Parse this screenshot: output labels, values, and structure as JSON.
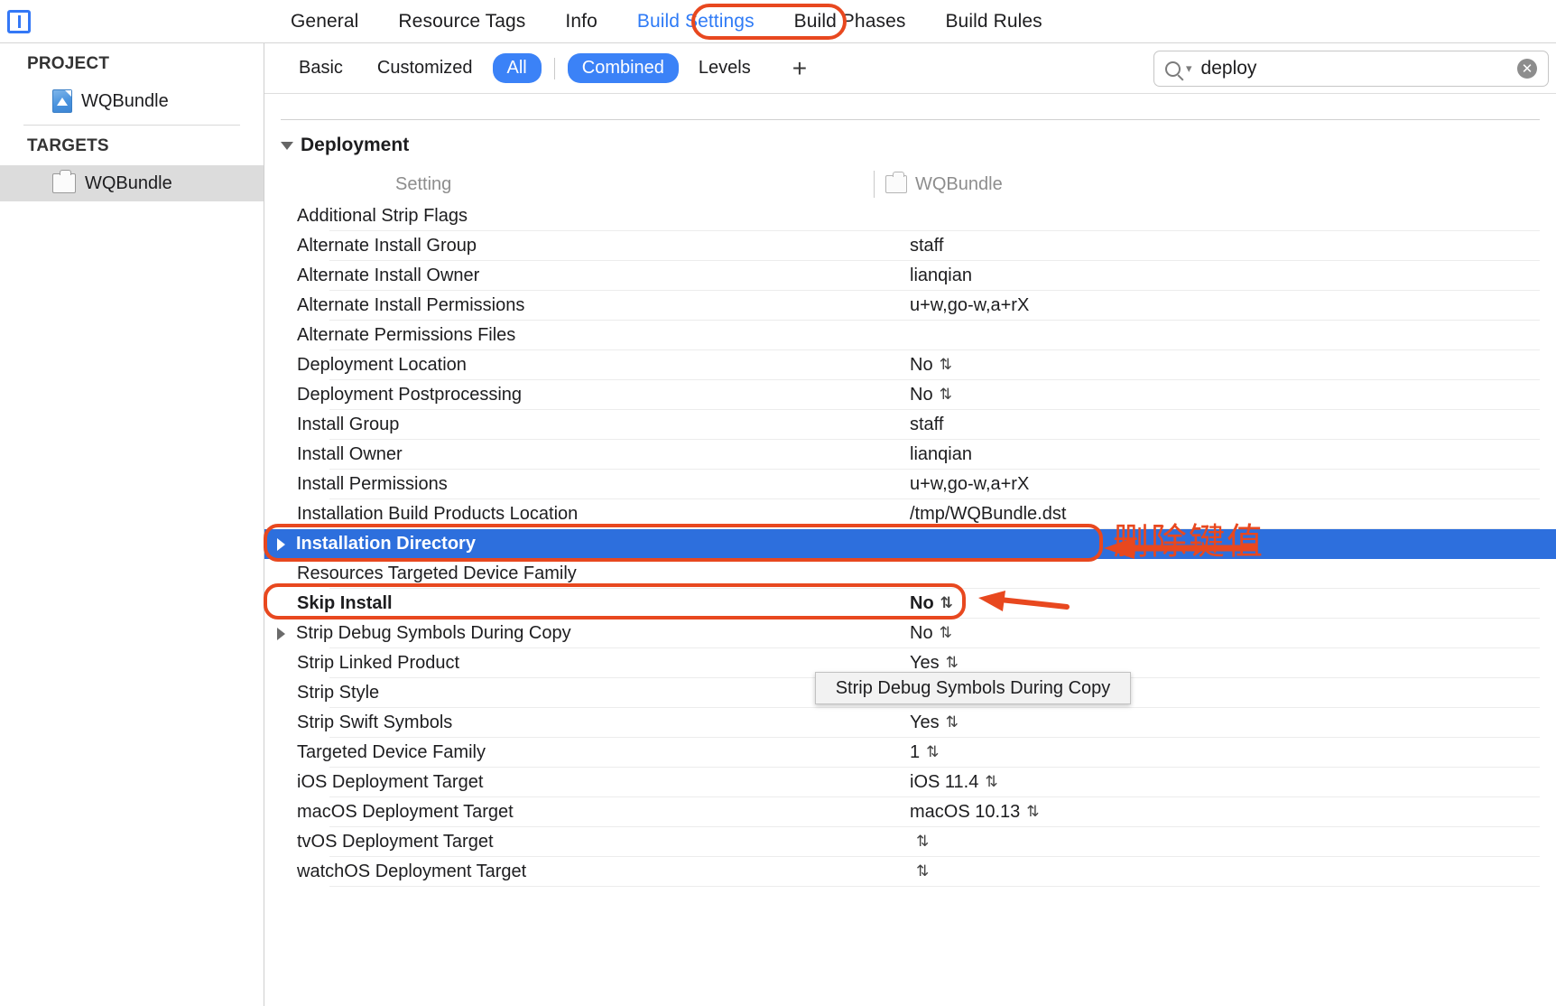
{
  "window": {
    "app_icon": "xcode-navigator-icon"
  },
  "tabs": [
    {
      "label": "General",
      "active": false
    },
    {
      "label": "Resource Tags",
      "active": false
    },
    {
      "label": "Info",
      "active": false
    },
    {
      "label": "Build Settings",
      "active": true
    },
    {
      "label": "Build Phases",
      "active": false
    },
    {
      "label": "Build Rules",
      "active": false
    }
  ],
  "sidebar": {
    "project_header": "PROJECT",
    "project_items": [
      {
        "label": "WQBundle",
        "icon": "xcode-project-icon"
      }
    ],
    "targets_header": "TARGETS",
    "target_items": [
      {
        "label": "WQBundle",
        "icon": "target-bundle-icon",
        "selected": true
      }
    ]
  },
  "filterbar": {
    "segments": [
      {
        "label": "Basic",
        "on": false
      },
      {
        "label": "Customized",
        "on": false
      },
      {
        "label": "All",
        "on": true
      },
      {
        "label": "Combined",
        "on": true
      },
      {
        "label": "Levels",
        "on": false
      }
    ],
    "add_label": "+",
    "search": {
      "value": "deploy",
      "placeholder": "",
      "icon": "search-icon",
      "clear_icon": "clear-circle-icon"
    }
  },
  "table": {
    "group_title": "Deployment",
    "col_setting": "Setting",
    "col_target": "WQBundle",
    "rows": [
      {
        "name": "Additional Strip Flags",
        "value": "",
        "stepper": false,
        "bold": false,
        "expandable": false,
        "selected": false
      },
      {
        "name": "Alternate Install Group",
        "value": "staff",
        "stepper": false,
        "bold": false,
        "expandable": false,
        "selected": false
      },
      {
        "name": "Alternate Install Owner",
        "value": "lianqian",
        "stepper": false,
        "bold": false,
        "expandable": false,
        "selected": false
      },
      {
        "name": "Alternate Install Permissions",
        "value": "u+w,go-w,a+rX",
        "stepper": false,
        "bold": false,
        "expandable": false,
        "selected": false
      },
      {
        "name": "Alternate Permissions Files",
        "value": "",
        "stepper": false,
        "bold": false,
        "expandable": false,
        "selected": false
      },
      {
        "name": "Deployment Location",
        "value": "No",
        "stepper": true,
        "bold": false,
        "expandable": false,
        "selected": false
      },
      {
        "name": "Deployment Postprocessing",
        "value": "No",
        "stepper": true,
        "bold": false,
        "expandable": false,
        "selected": false
      },
      {
        "name": "Install Group",
        "value": "staff",
        "stepper": false,
        "bold": false,
        "expandable": false,
        "selected": false
      },
      {
        "name": "Install Owner",
        "value": "lianqian",
        "stepper": false,
        "bold": false,
        "expandable": false,
        "selected": false
      },
      {
        "name": "Install Permissions",
        "value": "u+w,go-w,a+rX",
        "stepper": false,
        "bold": false,
        "expandable": false,
        "selected": false
      },
      {
        "name": "Installation Build Products Location",
        "value": "/tmp/WQBundle.dst",
        "stepper": false,
        "bold": false,
        "expandable": false,
        "selected": false
      },
      {
        "name": "Installation Directory",
        "value": "",
        "stepper": false,
        "bold": true,
        "expandable": true,
        "selected": true
      },
      {
        "name": "Resources Targeted Device Family",
        "value": "",
        "stepper": false,
        "bold": false,
        "expandable": false,
        "selected": false
      },
      {
        "name": "Skip Install",
        "value": "No",
        "stepper": true,
        "bold": true,
        "expandable": false,
        "selected": false
      },
      {
        "name": "Strip Debug Symbols During Copy",
        "value": "No",
        "stepper": true,
        "bold": false,
        "expandable": true,
        "selected": false
      },
      {
        "name": "Strip Linked Product",
        "value": "Yes",
        "stepper": true,
        "bold": false,
        "expandable": false,
        "selected": false
      },
      {
        "name": "Strip Style",
        "value": "",
        "stepper": false,
        "bold": false,
        "expandable": false,
        "selected": false
      },
      {
        "name": "Strip Swift Symbols",
        "value": "Yes",
        "stepper": true,
        "bold": false,
        "expandable": false,
        "selected": false
      },
      {
        "name": "Targeted Device Family",
        "value": "1",
        "stepper": true,
        "bold": false,
        "expandable": false,
        "selected": false
      },
      {
        "name": "iOS Deployment Target",
        "value": "iOS 11.4",
        "stepper": true,
        "bold": false,
        "expandable": false,
        "selected": false
      },
      {
        "name": "macOS Deployment Target",
        "value": "macOS 10.13",
        "stepper": true,
        "bold": false,
        "expandable": false,
        "selected": false
      },
      {
        "name": "tvOS Deployment Target",
        "value": "",
        "stepper": true,
        "bold": false,
        "expandable": false,
        "selected": false
      },
      {
        "name": "watchOS Deployment Target",
        "value": "",
        "stepper": true,
        "bold": false,
        "expandable": false,
        "selected": false
      }
    ]
  },
  "tooltip": {
    "text": "Strip Debug Symbols During Copy"
  },
  "annotations": {
    "chinese_note": "删除键值",
    "accent_color": "#e8481f",
    "selection_color": "#2d6fdd"
  }
}
